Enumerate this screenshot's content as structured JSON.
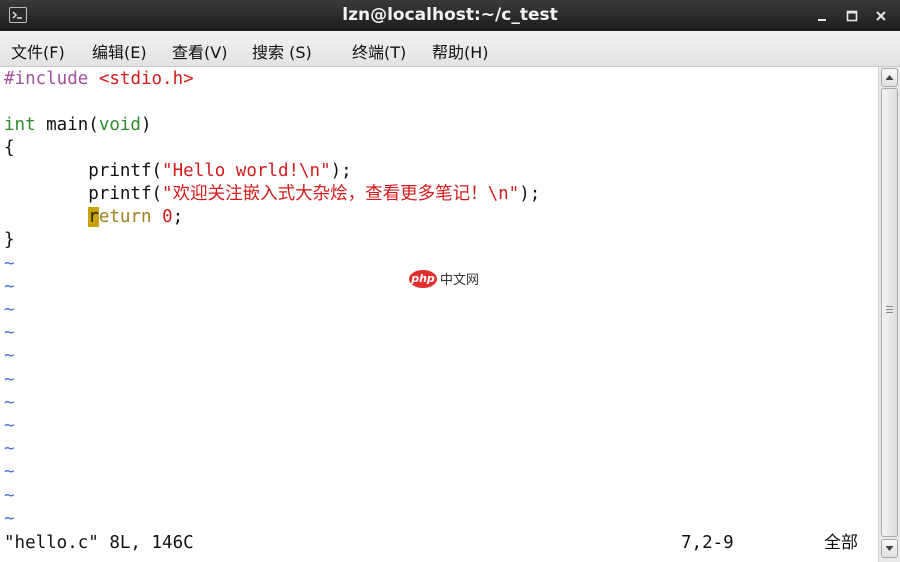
{
  "window": {
    "title": "lzn@localhost:~/c_test"
  },
  "menu": {
    "file": "文件(F)",
    "edit": "编辑(E)",
    "view": "查看(V)",
    "search": "搜索 (S)",
    "terminal": "终端(T)",
    "help": "帮助(H)"
  },
  "code": {
    "line1_directive": "#include",
    "line1_header": "<stdio.h>",
    "line3_type": "int",
    "line3_func": " main(",
    "line3_param": "void",
    "line3_close": ")",
    "line4": "{",
    "line5_indent": "        printf(",
    "line5_string": "\"Hello world!\\n\"",
    "line5_end": ");",
    "line6_indent": "        printf(",
    "line6_string": "\"欢迎关注嵌入式大杂烩，查看更多笔记！\\n\"",
    "line6_end": ");",
    "line7_indent": "        ",
    "line7_cursor_char": "r",
    "line7_keyword_rest": "eturn",
    "line7_space": " ",
    "line7_number": "0",
    "line7_end": ";",
    "line8": "}",
    "tilde": "~"
  },
  "status": {
    "file_info": "\"hello.c\" 8L, 146C",
    "position": "7,2-9",
    "scroll": "全部"
  },
  "watermark": {
    "logo": "php",
    "text": "中文网"
  }
}
